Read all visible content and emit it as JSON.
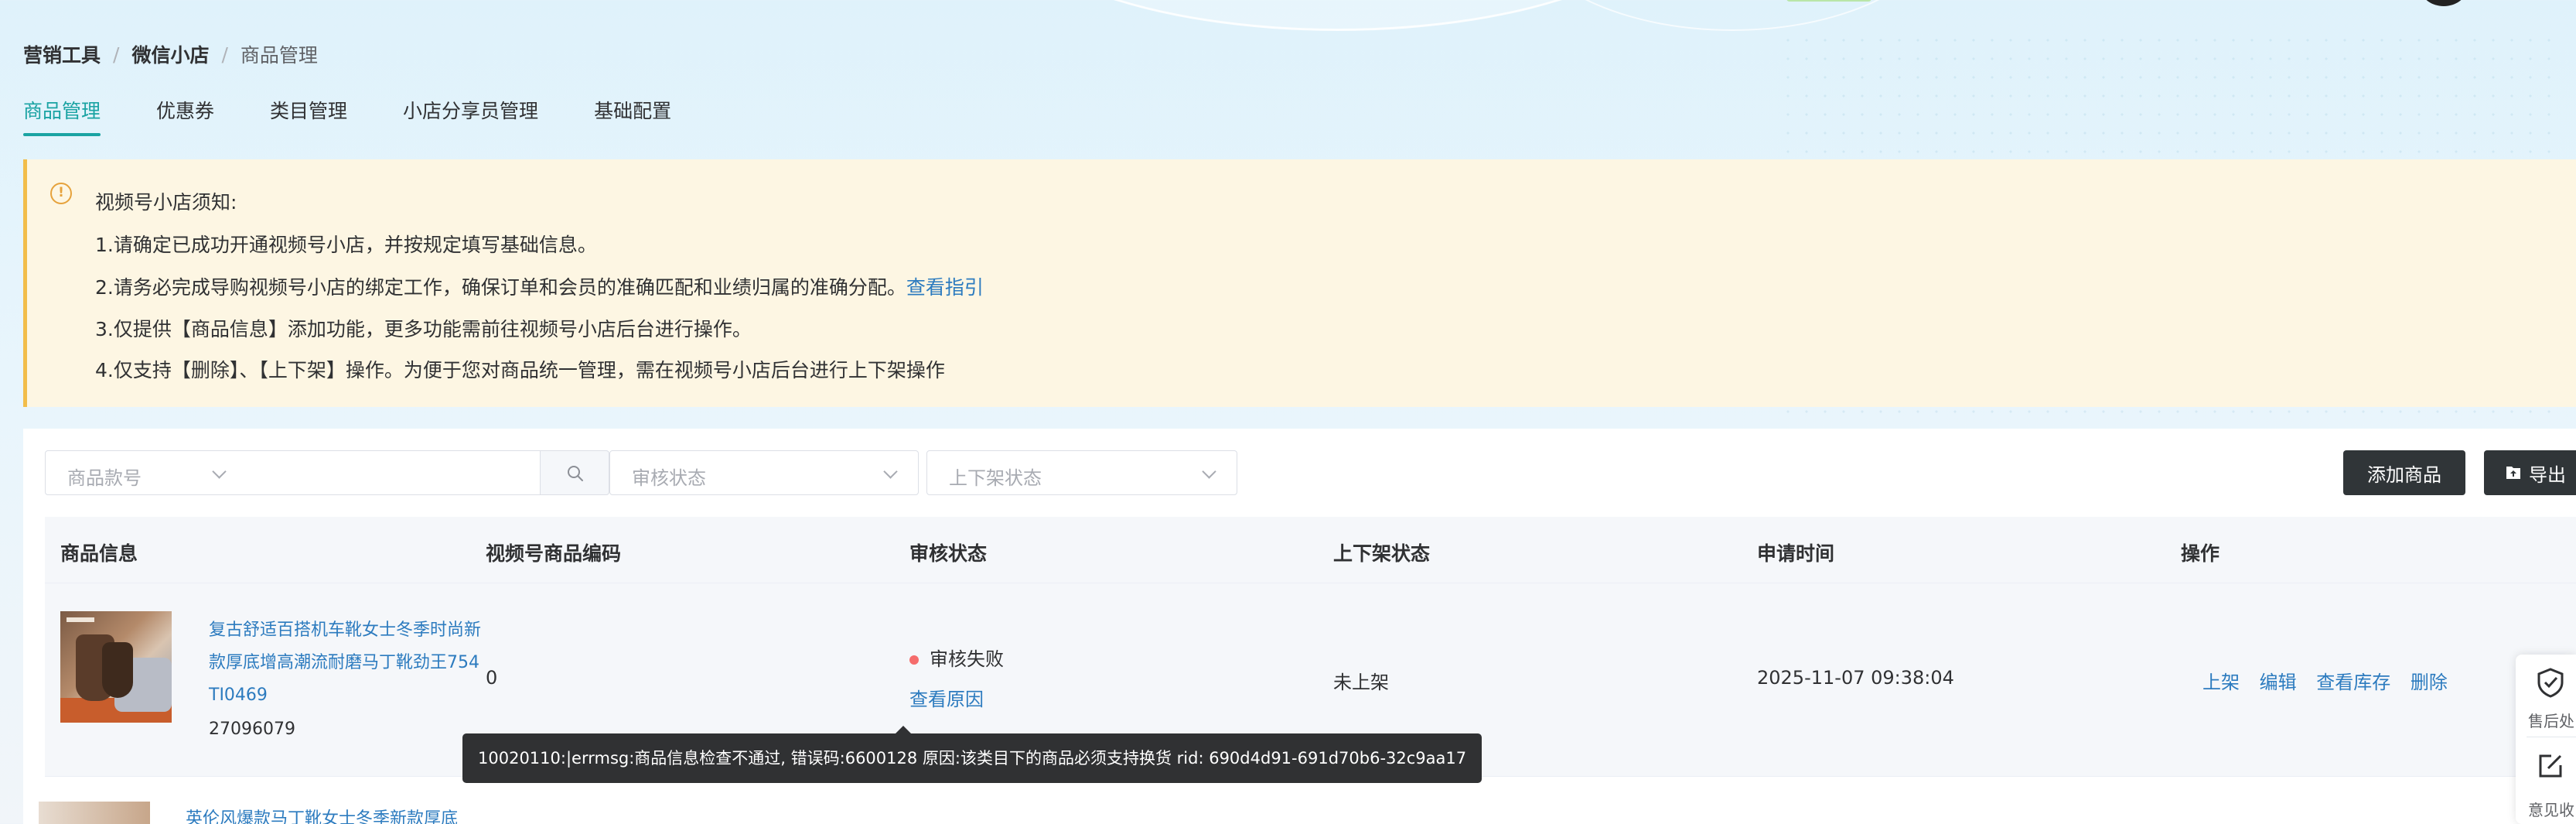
{
  "breadcrumb": {
    "items": [
      "营销工具",
      "微信小店",
      "商品管理"
    ],
    "separator": "/"
  },
  "tabs": [
    "商品管理",
    "优惠券",
    "类目管理",
    "小店分享员管理",
    "基础配置"
  ],
  "notice": {
    "title": "视频号小店须知:",
    "lines": [
      "1.请确定已成功开通视频号小店，并按规定填写基础信息。",
      "2.请务必完成导购视频号小店的绑定工作，确保订单和会员的准确匹配和业绩归属的准确分配。",
      "3.仅提供【商品信息】添加功能，更多功能需前往视频号小店后台进行操作。",
      "4.仅支持【删除】、【上下架】操作。为便于您对商品统一管理，需在视频号小店后台进行上下架操作"
    ],
    "link_text": "查看指引"
  },
  "filters": {
    "kind_placeholder": "商品款号",
    "search_value": "",
    "audit_placeholder": "审核状态",
    "shelf_placeholder": "上下架状态"
  },
  "actions": {
    "add_label": "添加商品",
    "export_label": "导出"
  },
  "table": {
    "headers": [
      "商品信息",
      "视频号商品编码",
      "审核状态",
      "上下架状态",
      "申请时间",
      "操作"
    ],
    "rows": [
      {
        "title": "复古舒适百搭机车靴女士冬季时尚新款厚底增高潮流耐磨马丁靴劲王754TI0469",
        "id": "27096079",
        "code": "0",
        "audit_status": "审核失败",
        "audit_link": "查看原因",
        "shelf_status": "未上架",
        "time": "2025-11-07 09:38:04",
        "ops": [
          "上架",
          "编辑",
          "查看库存",
          "删除"
        ]
      },
      {
        "title": "英伦风爆款马丁靴女士冬季新款厚底"
      }
    ]
  },
  "tooltip": "10020110:|errmsg:商品信息检查不通过, 错误码:6600128 原因:该类目下的商品必须支持换货 rid: 690d4d91-691d70b6-32c9aa17",
  "side_tools": [
    "售后处",
    "意见收"
  ],
  "colors": {
    "accent": "#1aa3a3",
    "link": "#2c7bbf",
    "notice_bg": "#fdf6e3",
    "notice_border": "#f2bd4a",
    "error_dot": "#f56c6c",
    "dark_button": "#303538"
  }
}
